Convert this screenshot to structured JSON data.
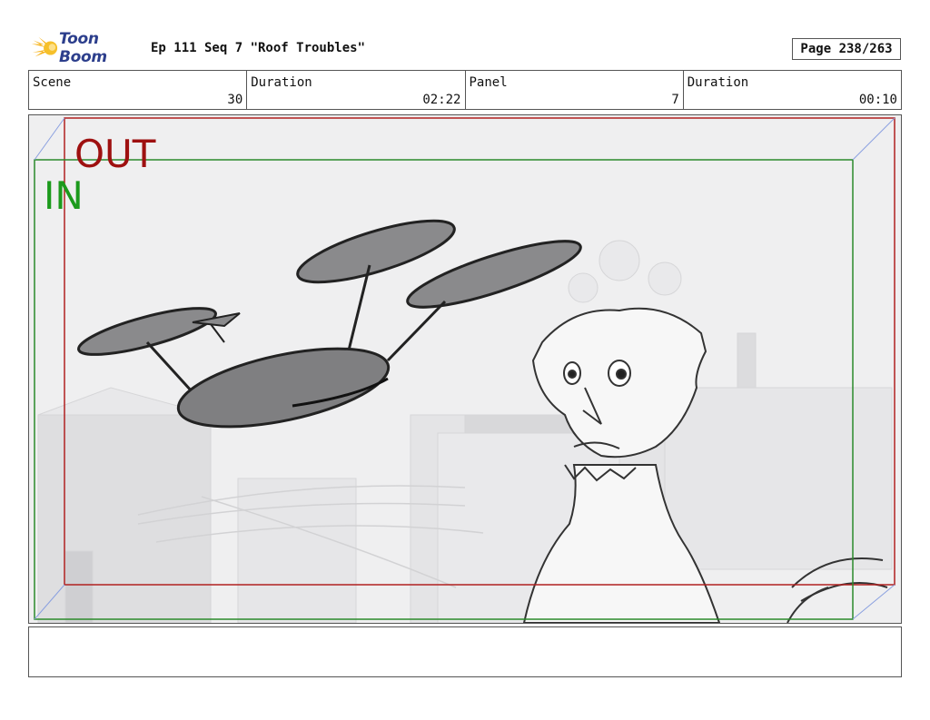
{
  "header": {
    "brand": "Toon Boom",
    "title": "Ep 111 Seq 7 \"Roof Troubles\"",
    "page": "Page 238/263"
  },
  "info": {
    "scene_label": "Scene",
    "scene_value": "30",
    "scene_duration_label": "Duration",
    "scene_duration_value": "02:22",
    "panel_label": "Panel",
    "panel_value": "7",
    "panel_duration_label": "Duration",
    "panel_duration_value": "00:10"
  },
  "frame": {
    "out_label": "OUT",
    "in_label": "IN",
    "out_color": "#9e1010",
    "in_color": "#1c9a1c"
  },
  "notes": {
    "text": ""
  },
  "icons": {
    "logo": "toon-boom-comet-icon"
  }
}
